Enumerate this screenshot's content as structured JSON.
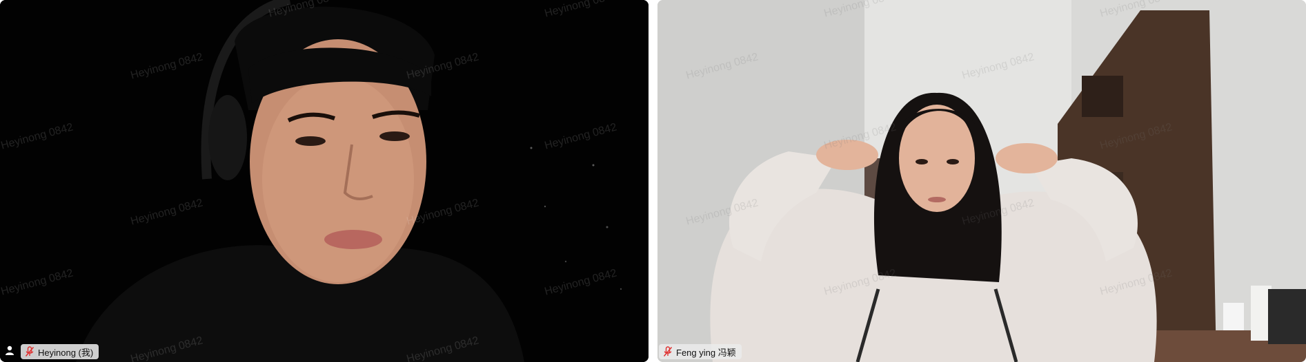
{
  "participants": [
    {
      "name_label": "Heyinong (我)",
      "mic_state": "muted",
      "mic_icon": "mic-muted-icon"
    },
    {
      "name_label": "Feng ying 冯颖",
      "mic_state": "muted",
      "mic_icon": "mic-muted-icon"
    }
  ],
  "watermark_text": "Heyinong 0842",
  "controls": {
    "user_icon": "user-icon"
  },
  "colors": {
    "left_video_bg": "#020202",
    "right_video_bg": "#d6d6d4",
    "mic_muted": "#e0302f",
    "name_tag_bg": "#ebebeb"
  }
}
